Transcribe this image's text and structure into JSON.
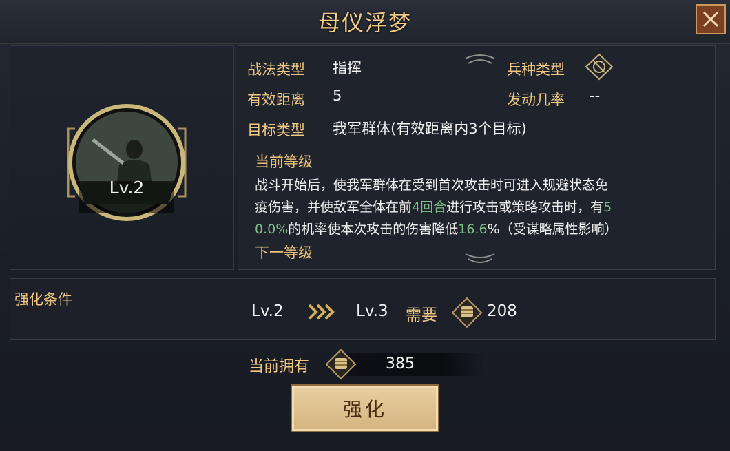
{
  "title": "母仪浮梦",
  "portrait": {
    "level": "Lv.2"
  },
  "info": {
    "tactic_type_label": "战法类型",
    "tactic_type_value": "指挥",
    "unit_type_label": "兵种类型",
    "range_label": "有效距离",
    "range_value": "5",
    "trigger_rate_label": "发动几率",
    "trigger_rate_value": "--",
    "target_label": "目标类型",
    "target_value": "我军群体(有效距离内3个目标)"
  },
  "description": {
    "current_heading": "当前等级",
    "line1": "战斗开始后，使我军群体在受到首次攻击时可进入规避状态免",
    "line2_a": "疫伤害，并使敌军全体在前",
    "line2_hl": "4回合",
    "line2_b": "进行攻击或策略攻击时，有",
    "line2_hl2": "5",
    "line3_hl": "0.0%",
    "line3_a": "的机率使本次攻击的伤害降低",
    "line3_hl2": "16.6",
    "line3_b": "%（受谋略属性影响）",
    "next_heading": "下一等级"
  },
  "upgrade": {
    "condition_label": "强化条件",
    "from_level": "Lv.2",
    "to_level": "Lv.3",
    "need_label": "需要",
    "need_amount": "208"
  },
  "owned": {
    "label": "当前拥有",
    "amount": "385"
  },
  "button": {
    "label": "强化"
  }
}
